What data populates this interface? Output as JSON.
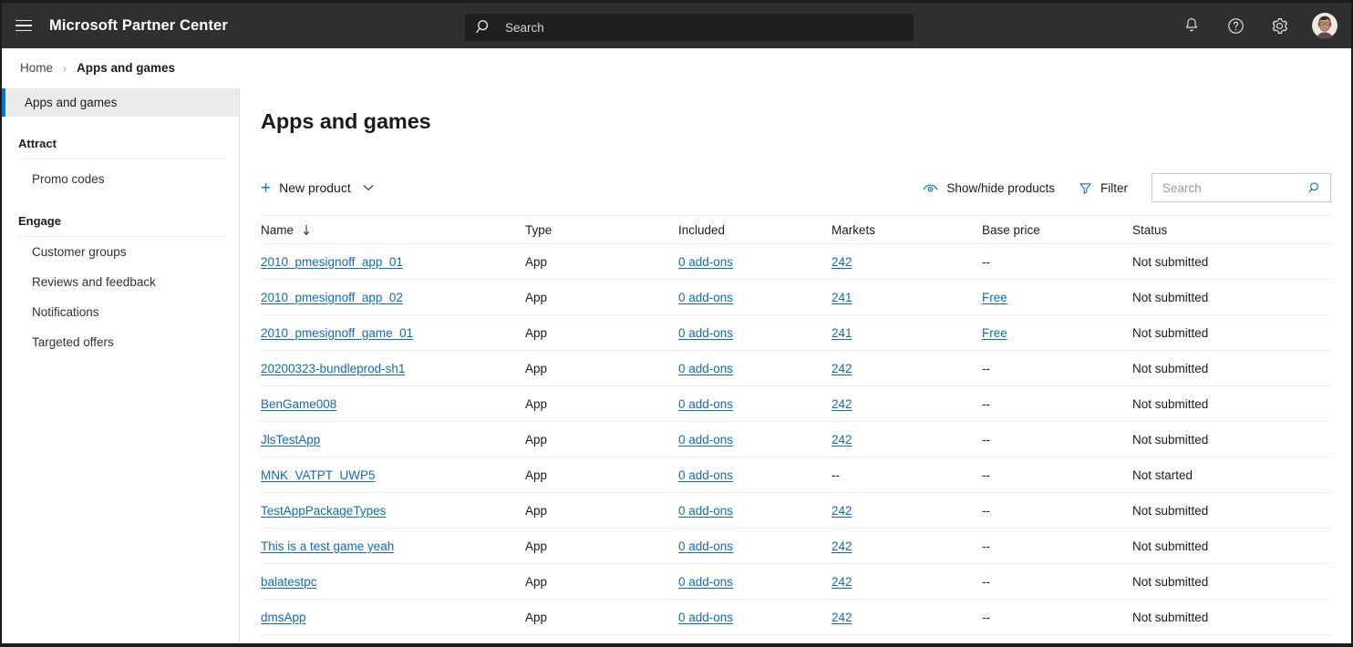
{
  "topbar": {
    "menu_icon": "hamburger-icon",
    "brand": "Microsoft Partner Center",
    "search": {
      "icon": "search-icon",
      "placeholder": "Search",
      "value": ""
    },
    "icons": [
      {
        "name": "notifications-icon",
        "label": "Notifications"
      },
      {
        "name": "help-icon",
        "label": "Help"
      },
      {
        "name": "settings-icon",
        "label": "Settings"
      }
    ],
    "avatar": {
      "name": "user-avatar",
      "label": "Account manager"
    },
    "background": "#2f2f2f"
  },
  "breadcrumb": {
    "items": [
      {
        "label": "Home",
        "current": false
      },
      {
        "label": "Apps and games",
        "current": true
      }
    ],
    "separator": "›"
  },
  "sidebar": {
    "selected": {
      "label": "Apps and games",
      "accent": "#0078d4"
    },
    "groups": [
      {
        "title": "Attract",
        "items": [
          {
            "label": "Promo codes"
          }
        ]
      },
      {
        "title": "Engage",
        "items": [
          {
            "label": "Customer groups"
          },
          {
            "label": "Reviews and feedback"
          },
          {
            "label": "Notifications"
          },
          {
            "label": "Targeted offers"
          }
        ]
      }
    ]
  },
  "main": {
    "title": "Apps and games",
    "toolbar": {
      "new_product": {
        "label": "New product",
        "icon": "plus-icon",
        "chevron": "chevron-down-icon"
      },
      "show_hide": {
        "label": "Show/hide products",
        "icon": "eye-icon"
      },
      "filter": {
        "label": "Filter",
        "icon": "filter-icon"
      },
      "search": {
        "placeholder": "Search",
        "value": "",
        "icon": "search-icon"
      }
    },
    "table": {
      "columns": [
        {
          "key": "name",
          "label": "Name",
          "sort": "desc",
          "sort_icon": "arrow-down-icon"
        },
        {
          "key": "type",
          "label": "Type"
        },
        {
          "key": "included",
          "label": "Included"
        },
        {
          "key": "markets",
          "label": "Markets"
        },
        {
          "key": "base_price",
          "label": "Base price"
        },
        {
          "key": "status",
          "label": "Status"
        }
      ],
      "rows": [
        {
          "name": "2010_pmesignoff_app_01",
          "type": "App",
          "included": "0 add-ons",
          "included_link": true,
          "markets": "242",
          "markets_link": true,
          "base_price": "--",
          "base_price_link": false,
          "status": "Not submitted"
        },
        {
          "name": "2010_pmesignoff_app_02",
          "type": "App",
          "included": "0 add-ons",
          "included_link": true,
          "markets": "241",
          "markets_link": true,
          "base_price": "Free",
          "base_price_link": true,
          "status": "Not submitted"
        },
        {
          "name": "2010_pmesignoff_game_01",
          "type": "App",
          "included": "0 add-ons",
          "included_link": true,
          "markets": "241",
          "markets_link": true,
          "base_price": "Free",
          "base_price_link": true,
          "status": "Not submitted"
        },
        {
          "name": "20200323-bundleprod-sh1",
          "type": "App",
          "included": "0 add-ons",
          "included_link": true,
          "markets": "242",
          "markets_link": true,
          "base_price": "--",
          "base_price_link": false,
          "status": "Not submitted"
        },
        {
          "name": "BenGame008",
          "type": "App",
          "included": "0 add-ons",
          "included_link": true,
          "markets": "242",
          "markets_link": true,
          "base_price": "--",
          "base_price_link": false,
          "status": "Not submitted"
        },
        {
          "name": "JlsTestApp",
          "type": "App",
          "included": "0 add-ons",
          "included_link": true,
          "markets": "242",
          "markets_link": true,
          "base_price": "--",
          "base_price_link": false,
          "status": "Not submitted"
        },
        {
          "name": "MNK_VATPT_UWP5",
          "type": "App",
          "included": "0 add-ons",
          "included_link": true,
          "markets": "--",
          "markets_link": false,
          "base_price": "--",
          "base_price_link": false,
          "status": "Not started"
        },
        {
          "name": "TestAppPackageTypes",
          "type": "App",
          "included": "0 add-ons",
          "included_link": true,
          "markets": "242",
          "markets_link": true,
          "base_price": "--",
          "base_price_link": false,
          "status": "Not submitted"
        },
        {
          "name": "This is a test game yeah",
          "type": "App",
          "included": "0 add-ons",
          "included_link": true,
          "markets": "242",
          "markets_link": true,
          "base_price": "--",
          "base_price_link": false,
          "status": "Not submitted"
        },
        {
          "name": "balatestpc",
          "type": "App",
          "included": "0 add-ons",
          "included_link": true,
          "markets": "242",
          "markets_link": true,
          "base_price": "--",
          "base_price_link": false,
          "status": "Not submitted"
        },
        {
          "name": "dmsApp",
          "type": "App",
          "included": "0 add-ons",
          "included_link": true,
          "markets": "242",
          "markets_link": true,
          "base_price": "--",
          "base_price_link": false,
          "status": "Not submitted"
        }
      ]
    }
  },
  "colors": {
    "link": "#0f6cbd",
    "accent": "#0078d4",
    "topbar_bg": "#2f2f2f",
    "selected_bg": "#ebebeb",
    "border": "#ededed"
  }
}
